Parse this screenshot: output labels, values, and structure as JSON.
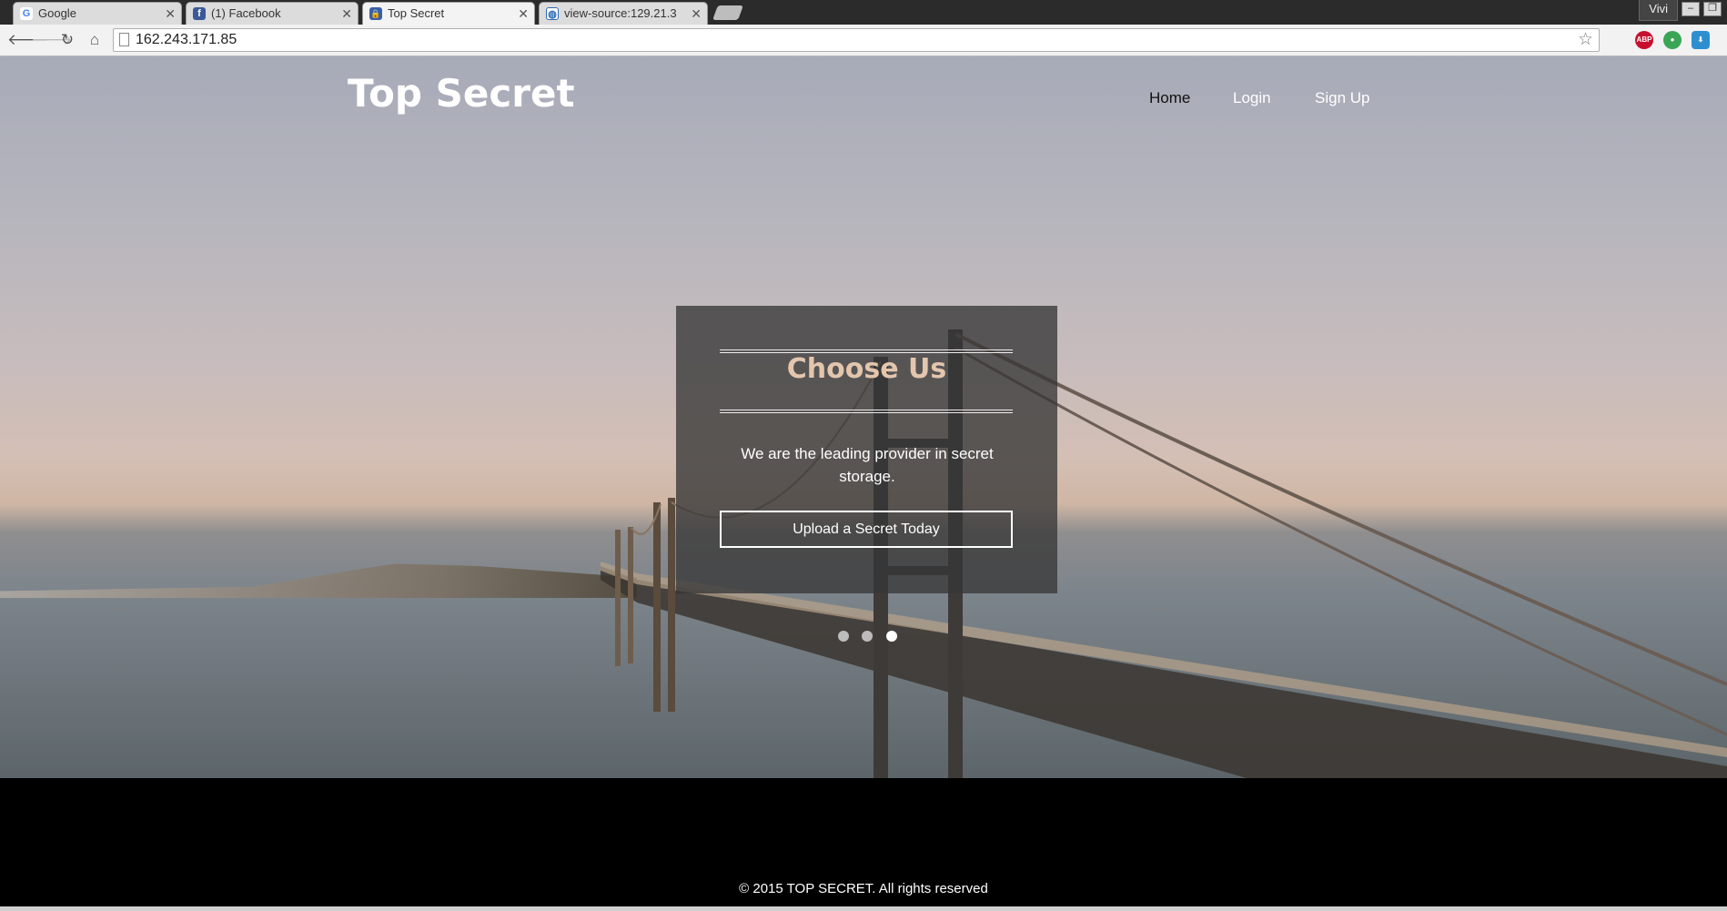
{
  "browser": {
    "tabs": [
      {
        "title": "Google",
        "favicon": "google-icon",
        "active": false
      },
      {
        "title": "(1) Facebook",
        "favicon": "facebook-icon",
        "active": false
      },
      {
        "title": "Top Secret",
        "favicon": "lock-icon",
        "active": true
      },
      {
        "title": "view-source:129.21.3",
        "favicon": "globe-icon",
        "active": false
      }
    ],
    "profile_name": "Vivi",
    "url": "162.243.171.85",
    "window_controls": [
      "minimize",
      "restore"
    ]
  },
  "site": {
    "brand": "Top Secret",
    "nav": [
      "Home",
      "Login",
      "Sign Up"
    ],
    "active_nav": "Home"
  },
  "slide": {
    "heading": "Choose Us",
    "text": "We are the leading provider in secret storage.",
    "cta": "Upload a Secret Today",
    "dot_count": 3,
    "active_dot": 3
  },
  "footer": {
    "copyright": "© 2015 TOP SECRET. All rights reserved"
  },
  "colors": {
    "heading_accent": "#e3c6ad",
    "card_overlay": "rgba(55,55,55,0.78)",
    "footer_bg": "#000000"
  }
}
